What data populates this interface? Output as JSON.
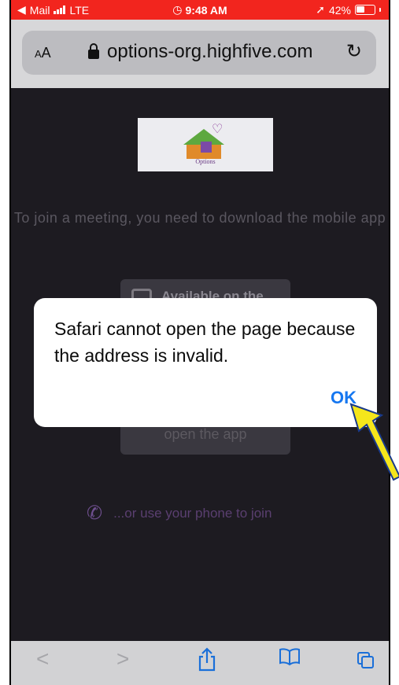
{
  "status_bar": {
    "back_app": "Mail",
    "network": "LTE",
    "time": "9:48 AM",
    "battery": "42%",
    "background_color": "#f2251e"
  },
  "address_bar": {
    "text_size_button": "AA",
    "url": "options-org.highfive.com",
    "reload_icon": "reload-icon",
    "lock_icon": "lock-icon"
  },
  "page": {
    "logo_text": "Options",
    "join_message": "To join a meeting, you need to download the mobile app",
    "store_button_label": "Available on the",
    "open_app_label": "open the app",
    "phone_join_label": "...or use your phone to join",
    "phone_icon": "phone-icon"
  },
  "dialog": {
    "message": "Safari cannot open the page because the address is invalid.",
    "ok_label": "OK",
    "ok_color": "#1677f0"
  },
  "toolbar": {
    "back_icon": "back-icon",
    "forward_icon": "forward-icon",
    "share_icon": "share-icon",
    "bookmarks_icon": "bookmarks-icon",
    "tabs_icon": "tabs-icon",
    "accent_color": "#1a6fd9"
  },
  "annotation": {
    "arrow_color": "#f5e61b",
    "arrow_icon": "pointer-arrow-icon"
  }
}
